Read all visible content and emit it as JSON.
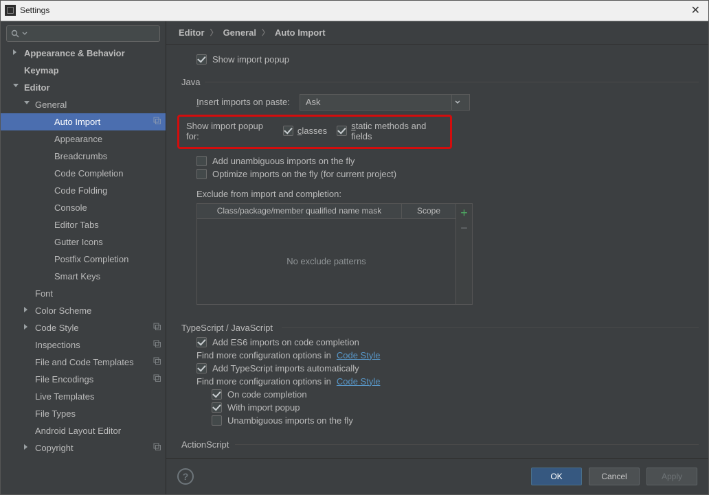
{
  "window": {
    "title": "Settings"
  },
  "search": {
    "placeholder": ""
  },
  "tree": [
    {
      "label": "Appearance & Behavior",
      "depth": 0,
      "arrow": "r",
      "bold": true
    },
    {
      "label": "Keymap",
      "depth": 0,
      "arrow": "",
      "bold": true
    },
    {
      "label": "Editor",
      "depth": 0,
      "arrow": "d",
      "bold": true
    },
    {
      "label": "General",
      "depth": 1,
      "arrow": "d"
    },
    {
      "label": "Auto Import",
      "depth": 2,
      "arrow": "",
      "selected": true,
      "dup": true
    },
    {
      "label": "Appearance",
      "depth": 2,
      "arrow": ""
    },
    {
      "label": "Breadcrumbs",
      "depth": 2,
      "arrow": ""
    },
    {
      "label": "Code Completion",
      "depth": 2,
      "arrow": ""
    },
    {
      "label": "Code Folding",
      "depth": 2,
      "arrow": ""
    },
    {
      "label": "Console",
      "depth": 2,
      "arrow": ""
    },
    {
      "label": "Editor Tabs",
      "depth": 2,
      "arrow": ""
    },
    {
      "label": "Gutter Icons",
      "depth": 2,
      "arrow": ""
    },
    {
      "label": "Postfix Completion",
      "depth": 2,
      "arrow": ""
    },
    {
      "label": "Smart Keys",
      "depth": 2,
      "arrow": ""
    },
    {
      "label": "Font",
      "depth": 1,
      "arrow": ""
    },
    {
      "label": "Color Scheme",
      "depth": 1,
      "arrow": "r"
    },
    {
      "label": "Code Style",
      "depth": 1,
      "arrow": "r",
      "dup": true
    },
    {
      "label": "Inspections",
      "depth": 1,
      "arrow": "",
      "dup": true
    },
    {
      "label": "File and Code Templates",
      "depth": 1,
      "arrow": "",
      "dup": true
    },
    {
      "label": "File Encodings",
      "depth": 1,
      "arrow": "",
      "dup": true
    },
    {
      "label": "Live Templates",
      "depth": 1,
      "arrow": ""
    },
    {
      "label": "File Types",
      "depth": 1,
      "arrow": ""
    },
    {
      "label": "Android Layout Editor",
      "depth": 1,
      "arrow": ""
    },
    {
      "label": "Copyright",
      "depth": 1,
      "arrow": "r",
      "dup": true
    }
  ],
  "breadcrumb": [
    "Editor",
    "General",
    "Auto Import"
  ],
  "xml": {
    "show_import_popup": "Show import popup"
  },
  "java": {
    "section": "Java",
    "insert_label": "Insert imports on paste:",
    "insert_value": "Ask",
    "popup_for": "Show import popup for:",
    "classes": "classes",
    "static": "static methods and fields",
    "add_unamb": "Add unambiguous imports on the fly",
    "optimize": "Optimize imports on the fly (for current project)",
    "exclude_label": "Exclude from import and completion:",
    "excl_col1": "Class/package/member qualified name mask",
    "excl_col2": "Scope",
    "excl_empty": "No exclude patterns"
  },
  "ts": {
    "section": "TypeScript / JavaScript",
    "add_es6": "Add ES6 imports on code completion",
    "hint1_a": "Find more configuration options in ",
    "link": "Code Style",
    "add_ts": "Add TypeScript imports automatically",
    "on_cc": "On code completion",
    "with_popup": "With import popup",
    "unamb": "Unambiguous imports on the fly"
  },
  "as": {
    "section": "ActionScript"
  },
  "buttons": {
    "ok": "OK",
    "cancel": "Cancel",
    "apply": "Apply"
  }
}
